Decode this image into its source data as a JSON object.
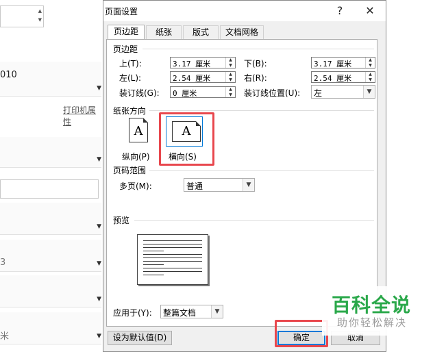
{
  "background": {
    "row1_text": "010",
    "link_text": "打印机属性",
    "row3_text": "3",
    "row4_text": "米"
  },
  "dialog": {
    "title": "页面设置",
    "help_glyph": "?",
    "close_glyph": "✕",
    "tabs": [
      "页边距",
      "纸张",
      "版式",
      "文档网格"
    ],
    "margins": {
      "section_label": "页边距",
      "top_label": "上(T):",
      "top_value": "3.17 厘米",
      "bottom_label": "下(B):",
      "bottom_value": "3.17 厘米",
      "left_label": "左(L):",
      "left_value": "2.54 厘米",
      "right_label": "右(R):",
      "right_value": "2.54 厘米",
      "gutter_label": "装订线(G):",
      "gutter_value": "0 厘米",
      "gutter_pos_label": "装订线位置(U):",
      "gutter_pos_value": "左"
    },
    "orientation": {
      "section_label": "纸张方向",
      "portrait_label": "纵向(P)",
      "landscape_label": "横向(S)",
      "icon_letter": "A",
      "selected": "landscape"
    },
    "pages": {
      "section_label": "页码范围",
      "multiple_label": "多页(M):",
      "multiple_value": "普通"
    },
    "preview": {
      "section_label": "预览"
    },
    "apply_to": {
      "label": "应用于(Y):",
      "value": "整篇文档"
    },
    "buttons": {
      "set_default": "设为默认值(D)",
      "ok": "确定",
      "cancel": "取消"
    }
  },
  "watermark": {
    "main": "百科全说",
    "sub": "助你轻松解决"
  },
  "colors": {
    "highlight": "#e8474d",
    "watermark_green": "#2aa84a",
    "focus_blue": "#0078d7"
  }
}
